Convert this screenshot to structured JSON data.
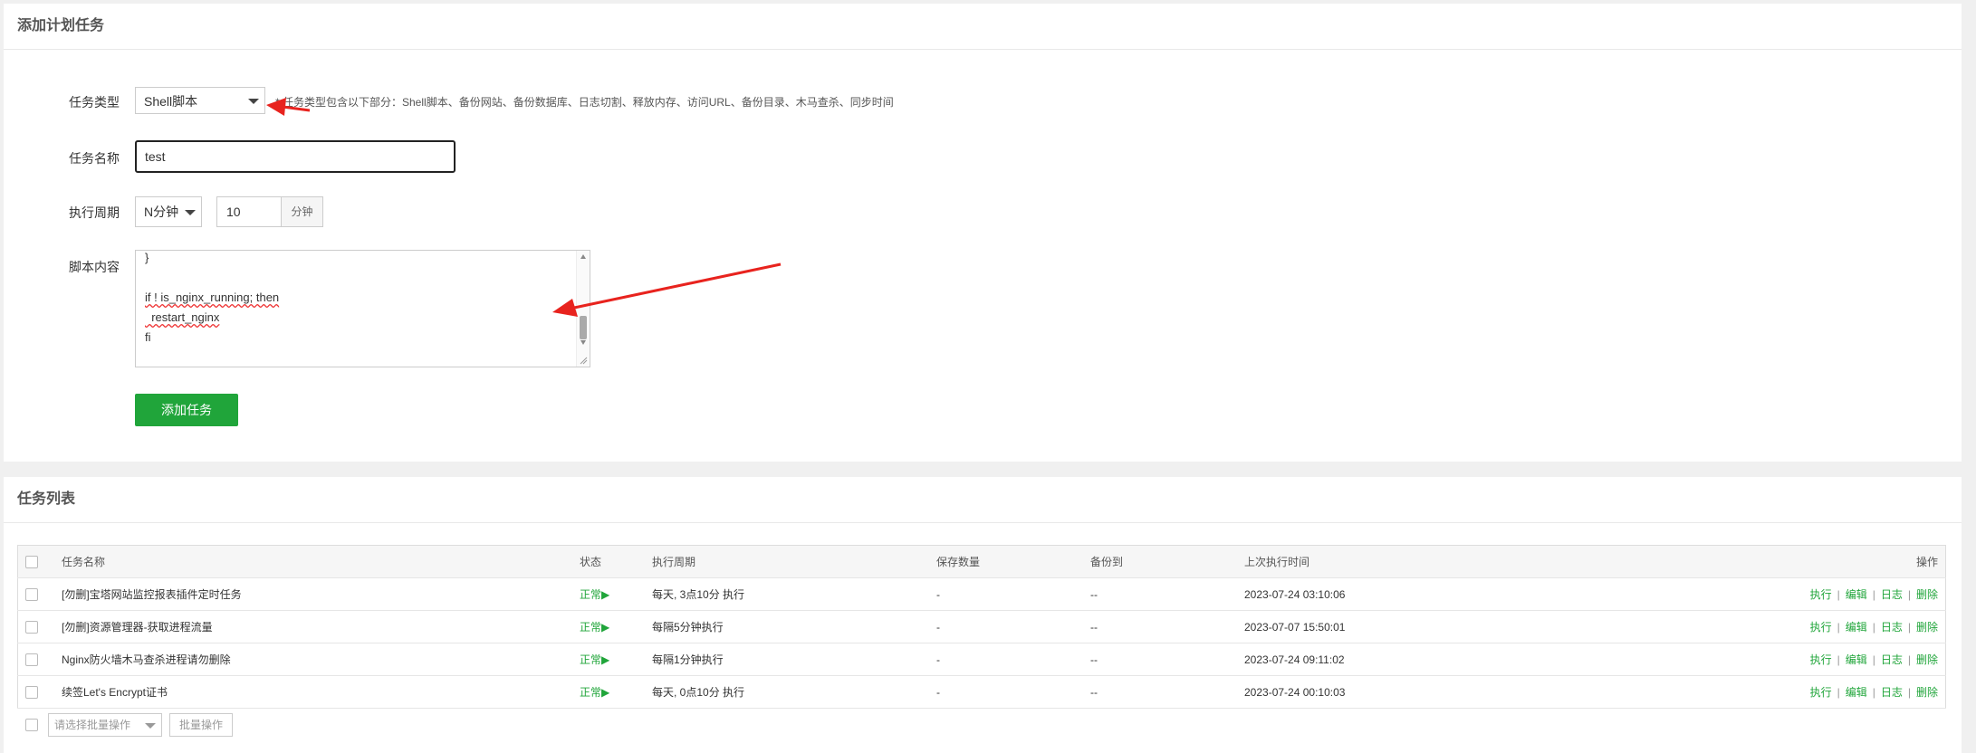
{
  "add_panel": {
    "title": "添加计划任务",
    "task_type": {
      "label": "任务类型",
      "value": "Shell脚本",
      "hint": "* 任务类型包含以下部分：Shell脚本、备份网站、备份数据库、日志切割、释放内存、访问URL、备份目录、木马查杀、同步时间"
    },
    "task_name": {
      "label": "任务名称",
      "value": "test"
    },
    "period": {
      "label": "执行周期",
      "unit_select": "N分钟",
      "value": "10",
      "addon": "分钟"
    },
    "script": {
      "label": "脚本内容",
      "lines": [
        "}",
        "",
        "if ! is_nginx_running; then",
        "  restart_nginx",
        "fi"
      ]
    },
    "submit_label": "添加任务"
  },
  "list_panel": {
    "title": "任务列表",
    "columns": [
      "任务名称",
      "状态",
      "执行周期",
      "保存数量",
      "备份到",
      "上次执行时间",
      "操作"
    ],
    "rows": [
      {
        "name": "[勿删]宝塔网站监控报表插件定时任务",
        "status": "正常▶",
        "period": "每天, 3点10分 执行",
        "keep": "-",
        "backup_to": "--",
        "last_run": "2023-07-24 03:10:06"
      },
      {
        "name": "[勿删]资源管理器-获取进程流量",
        "status": "正常▶",
        "period": "每隔5分钟执行",
        "keep": "-",
        "backup_to": "--",
        "last_run": "2023-07-07 15:50:01"
      },
      {
        "name": "Nginx防火墙木马查杀进程请勿删除",
        "status": "正常▶",
        "period": "每隔1分钟执行",
        "keep": "-",
        "backup_to": "--",
        "last_run": "2023-07-24 09:11:02"
      },
      {
        "name": "续签Let's Encrypt证书",
        "status": "正常▶",
        "period": "每天, 0点10分 执行",
        "keep": "-",
        "backup_to": "--",
        "last_run": "2023-07-24 00:10:03"
      }
    ],
    "actions": {
      "run": "执行",
      "edit": "编辑",
      "log": "日志",
      "delete": "删除",
      "sep": "|"
    },
    "bulk": {
      "select_placeholder": "请选择批量操作",
      "button": "批量操作"
    }
  },
  "colors": {
    "accent": "#20a53a",
    "annotation_arrow": "#e8231e"
  }
}
